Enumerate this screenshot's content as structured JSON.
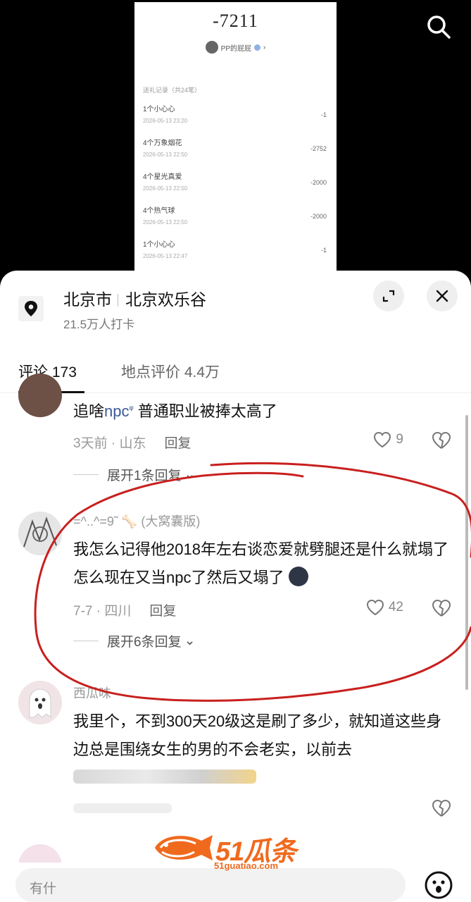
{
  "screenshot": {
    "amount": "-7211",
    "username": "PP的屁屁",
    "records_header": "送礼记录（共24笔）",
    "gifts": [
      {
        "name": "1个小心心",
        "date": "2026-05-13 23:20",
        "value": "-1"
      },
      {
        "name": "4个万象烟花",
        "date": "2026-05-13 22:50",
        "value": "-2752"
      },
      {
        "name": "4个星光真爱",
        "date": "2026-05-13 22:50",
        "value": "-2000"
      },
      {
        "name": "4个热气球",
        "date": "2026-05-13 22:50",
        "value": "-2000"
      },
      {
        "name": "1个小心心",
        "date": "2026-05-13 22:47",
        "value": "-1"
      }
    ]
  },
  "location": {
    "city": "北京市",
    "place": "北京欢乐谷",
    "checkins": "21.5万人打卡"
  },
  "tabs": {
    "comments": "评论 173",
    "reviews": "地点评价 4.4万"
  },
  "comments": [
    {
      "username": "",
      "text_prefix": "追啥",
      "text_link": "npc",
      "text_suffix": " 普通职业被捧太高了",
      "meta": "3天前 · 山东",
      "reply": "回复",
      "likes": "9",
      "expand": "展开1条回复"
    },
    {
      "username": "=^..^=9˜ 🦴 (大窝囊版)",
      "text": "我怎么记得他2018年左右谈恋爱就劈腿还是什么就塌了怎么现在又当npc了然后又塌了",
      "meta": "7-7 · 四川",
      "reply": "回复",
      "likes": "42",
      "expand": "展开6条回复"
    },
    {
      "username": "西瓜味",
      "text": "我里个，不到300天20级这是刷了多少，就知道这些身边总是围绕女生的男的不会老实，以前去"
    }
  ],
  "input": {
    "placeholder": "有什"
  },
  "watermark": {
    "brand": "51瓜条",
    "url": "51guatiao.com"
  },
  "colors": {
    "link": "#3b5998",
    "annotation": "#c8201e",
    "watermark": "#f06a1e"
  }
}
